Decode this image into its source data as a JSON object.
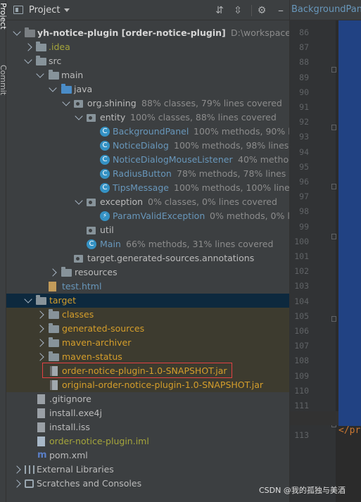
{
  "strip": {
    "tabs": [
      "Project",
      "Commit"
    ]
  },
  "panel": {
    "title": "Project"
  },
  "tree": [
    {
      "label": "yh-notice-plugin [order-notice-plugin]",
      "extra": "D:\\workspace\\yh-noti",
      "icon": "module-folder-icon",
      "color": "c-bold"
    },
    {
      "label": ".idea",
      "icon": "folder-icon",
      "color": "c-yellow"
    },
    {
      "label": "src",
      "icon": "folder-icon",
      "color": "c-default"
    },
    {
      "label": "main",
      "icon": "folder-icon",
      "color": "c-default"
    },
    {
      "label": "java",
      "icon": "source-folder-icon",
      "color": "c-default"
    },
    {
      "label": "org.shining",
      "extra": "88% classes, 79% lines covered",
      "icon": "package-icon",
      "color": "c-default"
    },
    {
      "label": "entity",
      "extra": "100% classes, 88% lines covered",
      "icon": "package-icon",
      "color": "c-default"
    },
    {
      "label": "BackgroundPanel",
      "extra": "100% methods, 90% line",
      "icon": "class-icon",
      "color": "c-blue"
    },
    {
      "label": "NoticeDialog",
      "extra": "100% methods, 98% lines cov",
      "icon": "class-icon",
      "color": "c-blue"
    },
    {
      "label": "NoticeDialogMouseListener",
      "extra": "40% methods,",
      "icon": "class-icon",
      "color": "c-blue"
    },
    {
      "label": "RadiusButton",
      "extra": "78% methods, 78% lines cove",
      "icon": "class-icon",
      "color": "c-blue"
    },
    {
      "label": "TipsMessage",
      "extra": "100% methods, 100% lines c",
      "icon": "class-icon",
      "color": "c-blue"
    },
    {
      "label": "exception",
      "extra": "0% classes, 0% lines covered",
      "icon": "package-icon",
      "color": "c-default"
    },
    {
      "label": "ParamValidException",
      "extra": "0% methods, 0% line",
      "icon": "exception-class-icon",
      "color": "c-blue"
    },
    {
      "label": "util",
      "icon": "package-icon",
      "color": "c-default"
    },
    {
      "label": "Main",
      "extra": "66% methods, 31% lines covered",
      "icon": "main-class-icon",
      "color": "c-blue"
    },
    {
      "label": "target.generated-sources.annotations",
      "icon": "package-icon",
      "color": "c-default"
    },
    {
      "label": "resources",
      "icon": "resources-folder-icon",
      "color": "c-default"
    },
    {
      "label": "test.html",
      "icon": "html-file-icon",
      "color": "c-blue"
    },
    {
      "label": "target",
      "icon": "folder-icon",
      "color": "c-orange"
    },
    {
      "label": "classes",
      "icon": "folder-icon",
      "color": "c-orange"
    },
    {
      "label": "generated-sources",
      "icon": "folder-icon",
      "color": "c-orange"
    },
    {
      "label": "maven-archiver",
      "icon": "folder-icon",
      "color": "c-orange"
    },
    {
      "label": "maven-status",
      "icon": "folder-icon",
      "color": "c-orange"
    },
    {
      "label": "order-notice-plugin-1.0-SNAPSHOT.jar",
      "icon": "jar-file-icon",
      "color": "c-orange"
    },
    {
      "label": "original-order-notice-plugin-1.0-SNAPSHOT.jar",
      "icon": "jar-file-icon",
      "color": "c-orange"
    },
    {
      "label": ".gitignore",
      "icon": "text-file-icon",
      "color": "c-default"
    },
    {
      "label": "install.exe4j",
      "icon": "text-file-icon",
      "color": "c-default"
    },
    {
      "label": "install.iss",
      "icon": "text-file-icon",
      "color": "c-default"
    },
    {
      "label": "order-notice-plugin.iml",
      "icon": "iml-file-icon",
      "color": "c-yellow"
    },
    {
      "label": "pom.xml",
      "icon": "maven-icon",
      "color": "c-default"
    },
    {
      "label": "External Libraries",
      "icon": "libraries-icon",
      "color": "c-default"
    },
    {
      "label": "Scratches and Consoles",
      "icon": "scratches-icon",
      "color": "c-default"
    }
  ],
  "editor": {
    "tab_label": "BackgroundPanel",
    "line_numbers": [
      "86",
      "87",
      "88",
      "89",
      "90",
      "91",
      "92",
      "93",
      "94",
      "95",
      "96",
      "97",
      "98",
      "99",
      "100",
      "101",
      "102",
      "103",
      "104",
      "105",
      "106",
      "107",
      "108",
      "109",
      "110",
      "111",
      "112",
      "113"
    ],
    "current_line": "112",
    "visible_code": "</pr"
  },
  "watermark": "CSDN @我的孤独与美酒",
  "colors": {
    "panel_bg": "#3c3f41",
    "editor_bg": "#2b2b2b",
    "target_row_bg": "#0d293e",
    "excluded_bg": "#3d3b2f",
    "highlight_border": "#e34143",
    "selection_block": "#214283"
  }
}
